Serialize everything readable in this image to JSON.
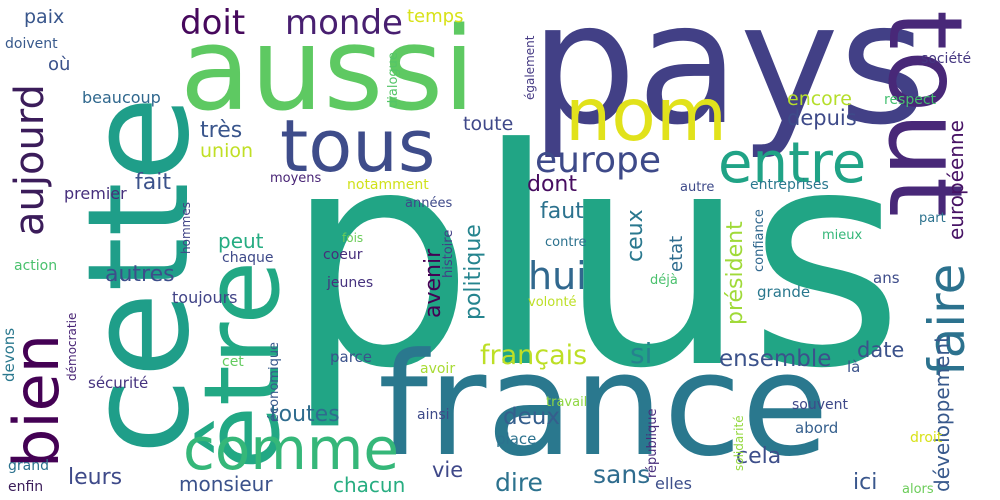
{
  "words": [
    {
      "text": "plus",
      "color": "#21a585"
    },
    {
      "text": "pays",
      "color": "#424086"
    },
    {
      "text": "cette",
      "color": "#1f9e89"
    },
    {
      "text": "aussi",
      "color": "#5ec962"
    },
    {
      "text": "france",
      "color": "#2a788e"
    },
    {
      "text": "être",
      "color": "#22a884"
    },
    {
      "text": "tout",
      "color": "#482878"
    },
    {
      "text": "tous",
      "color": "#3e4c8a"
    },
    {
      "text": "nom",
      "color": "#e1e21b"
    },
    {
      "text": "comme",
      "color": "#35b779"
    },
    {
      "text": "bien",
      "color": "#440154"
    },
    {
      "text": "entre",
      "color": "#20a386"
    },
    {
      "text": "faire",
      "color": "#2c728e"
    },
    {
      "text": "aujourd",
      "color": "#3b1c5a"
    },
    {
      "text": "monde",
      "color": "#481f70"
    },
    {
      "text": "doit",
      "color": "#46085c"
    },
    {
      "text": "europe",
      "color": "#3e4a89"
    },
    {
      "text": "hui",
      "color": "#31688e"
    },
    {
      "text": "français",
      "color": "#bddf26"
    },
    {
      "text": "développement",
      "color": "#38598c"
    },
    {
      "text": "européenne",
      "color": "#471365"
    },
    {
      "text": "président",
      "color": "#a0da39"
    },
    {
      "text": "politique",
      "color": "#25848e"
    },
    {
      "text": "ensemble",
      "color": "#3b528b"
    },
    {
      "text": "toutes",
      "color": "#2f6c8e"
    },
    {
      "text": "autres",
      "color": "#3d4e8a"
    },
    {
      "text": "avenir",
      "color": "#440154"
    },
    {
      "text": "faut",
      "color": "#2c728e"
    },
    {
      "text": "fait",
      "color": "#3b528b"
    },
    {
      "text": "dont",
      "color": "#470d60"
    },
    {
      "text": "ceux",
      "color": "#2a788e"
    },
    {
      "text": "depuis",
      "color": "#3e4a89"
    },
    {
      "text": "encore",
      "color": "#b5de2b"
    },
    {
      "text": "très",
      "color": "#39558c"
    },
    {
      "text": "union",
      "color": "#c0df25"
    },
    {
      "text": "toute",
      "color": "#3f4889"
    },
    {
      "text": "temps",
      "color": "#d8e219"
    },
    {
      "text": "paix",
      "color": "#39568c"
    },
    {
      "text": "où",
      "color": "#3b528b"
    },
    {
      "text": "beaucoup",
      "color": "#30688e"
    },
    {
      "text": "premier",
      "color": "#462f7c"
    },
    {
      "text": "peut",
      "color": "#25ac82"
    },
    {
      "text": "toujours",
      "color": "#414487"
    },
    {
      "text": "chaque",
      "color": "#3e4989"
    },
    {
      "text": "coeur",
      "color": "#472d7b"
    },
    {
      "text": "jeunes",
      "color": "#46327e"
    },
    {
      "text": "moyens",
      "color": "#482475"
    },
    {
      "text": "notamment",
      "color": "#d0e11c"
    },
    {
      "text": "années",
      "color": "#3e4989"
    },
    {
      "text": "histoire",
      "color": "#424086"
    },
    {
      "text": "dialogue",
      "color": "#54c568"
    },
    {
      "text": "également",
      "color": "#443983"
    },
    {
      "text": "doivent",
      "color": "#38598c"
    },
    {
      "text": "société",
      "color": "#453781"
    },
    {
      "text": "respect",
      "color": "#44bf70"
    },
    {
      "text": "autre",
      "color": "#3e4a89"
    },
    {
      "text": "entreprises",
      "color": "#2a788e"
    },
    {
      "text": "confiance",
      "color": "#31688e"
    },
    {
      "text": "part",
      "color": "#2c728e"
    },
    {
      "text": "mieux",
      "color": "#35b779"
    },
    {
      "text": "contre",
      "color": "#2c728e"
    },
    {
      "text": "grande",
      "color": "#2a788e"
    },
    {
      "text": "ans",
      "color": "#3e4c8a"
    },
    {
      "text": "déjà",
      "color": "#4ac16d"
    },
    {
      "text": "volonté",
      "color": "#bddf26"
    },
    {
      "text": "etat",
      "color": "#2f6c8e"
    },
    {
      "text": "date",
      "color": "#3b528b"
    },
    {
      "text": "si",
      "color": "#26828e"
    },
    {
      "text": "deux",
      "color": "#355f8d"
    },
    {
      "text": "cela",
      "color": "#3d4e8a"
    },
    {
      "text": "vie",
      "color": "#3f4889"
    },
    {
      "text": "dire",
      "color": "#2c728e"
    },
    {
      "text": "sans",
      "color": "#2f6c8e"
    },
    {
      "text": "chacun",
      "color": "#27ad81"
    },
    {
      "text": "monsieur",
      "color": "#3b528b"
    },
    {
      "text": "leurs",
      "color": "#3e4a89"
    },
    {
      "text": "ici",
      "color": "#39568c"
    },
    {
      "text": "elles",
      "color": "#3d4e8a"
    },
    {
      "text": "alors",
      "color": "#6ccd5a"
    },
    {
      "text": "droit",
      "color": "#d8e219"
    },
    {
      "text": "souvent",
      "color": "#3e4989"
    },
    {
      "text": "abord",
      "color": "#355f8d"
    },
    {
      "text": "là",
      "color": "#3b528b"
    },
    {
      "text": "solidarité",
      "color": "#95d840"
    },
    {
      "text": "république",
      "color": "#472d7b"
    },
    {
      "text": "travail",
      "color": "#8fd744"
    },
    {
      "text": "place",
      "color": "#2c728e"
    },
    {
      "text": "ainsi",
      "color": "#3e4a89"
    },
    {
      "text": "avoir",
      "color": "#a8db34"
    },
    {
      "text": "parce",
      "color": "#3b528b"
    },
    {
      "text": "cet",
      "color": "#63cb5f"
    },
    {
      "text": "économique",
      "color": "#38598c"
    },
    {
      "text": "sécurité",
      "color": "#46337f"
    },
    {
      "text": "démocratie",
      "color": "#482475"
    },
    {
      "text": "devons",
      "color": "#2a788e"
    },
    {
      "text": "grand",
      "color": "#2c728e"
    },
    {
      "text": "enfin",
      "color": "#3b1c5a"
    },
    {
      "text": "action",
      "color": "#4ac16d"
    },
    {
      "text": "hommes",
      "color": "#414487"
    },
    {
      "text": "fois",
      "color": "#6ccd5a"
    }
  ]
}
